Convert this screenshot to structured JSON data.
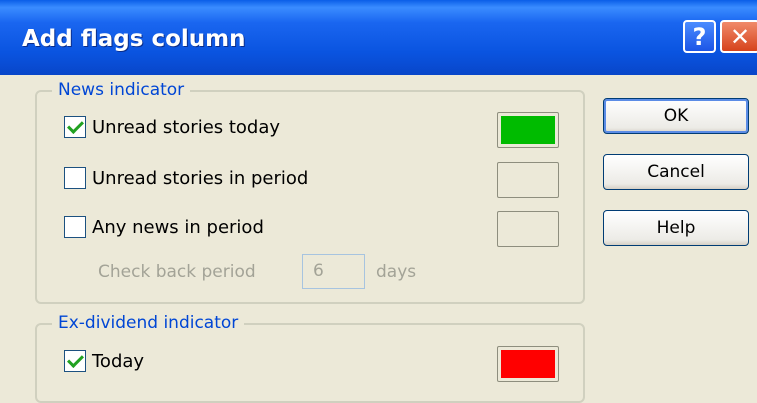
{
  "window": {
    "title": "Add flags column",
    "help_btn": "?",
    "close_btn": "✕"
  },
  "news": {
    "group_label": "News indicator",
    "items": [
      {
        "label": "Unread stories today",
        "checked": true,
        "color": "#00bb00"
      },
      {
        "label": "Unread stories in period",
        "checked": false,
        "color": ""
      },
      {
        "label": "Any news in period",
        "checked": false,
        "color": ""
      }
    ],
    "check_back_label": "Check back period",
    "check_back_value": "6",
    "days_label": "days"
  },
  "dividend": {
    "group_label": "Ex-dividend indicator",
    "items": [
      {
        "label": "Today",
        "checked": true,
        "color": "#ff0000"
      }
    ]
  },
  "buttons": {
    "ok": "OK",
    "cancel": "Cancel",
    "help": "Help"
  }
}
